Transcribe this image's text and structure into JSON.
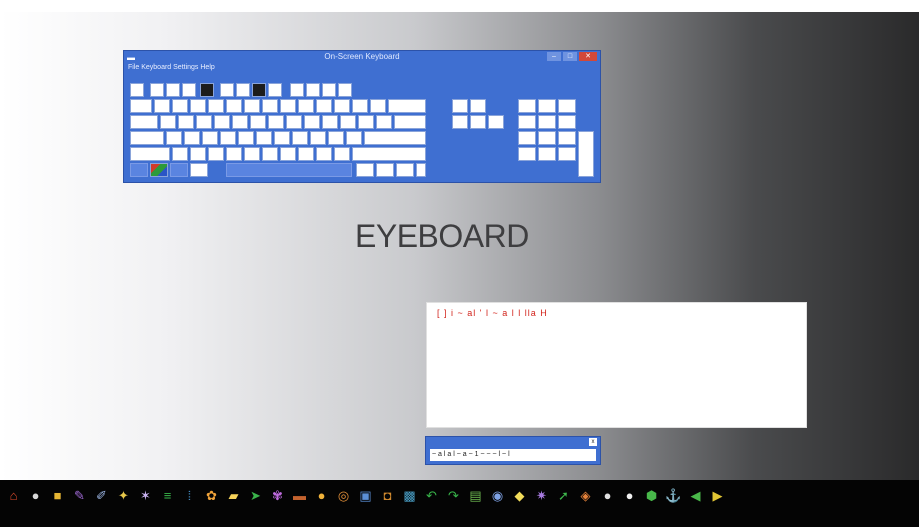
{
  "keyboard_window": {
    "title": "On-Screen Keyboard",
    "menu": "File Keyboard Settings Help",
    "controls": {
      "minimize": "–",
      "maximize": "□",
      "close": "✕"
    }
  },
  "app_title": "EYEBOARD",
  "output": {
    "typed_text": "[ ] i ~ al ' l ~ a l l lla H"
  },
  "mini_window": {
    "row_text": "~ a l a l ~ a ~ 1 ~ ~ ~ l ~ l",
    "close": "x"
  },
  "taskbar": {
    "icons": [
      {
        "name": "home-icon",
        "glyph": "⌂",
        "color": "#e04b2d"
      },
      {
        "name": "disc-icon",
        "glyph": "●",
        "color": "#d8d8d8"
      },
      {
        "name": "folder-icon",
        "glyph": "■",
        "color": "#e6b533"
      },
      {
        "name": "pencil-icon",
        "glyph": "✎",
        "color": "#a06ad6"
      },
      {
        "name": "brush-icon",
        "glyph": "✐",
        "color": "#9ab3e0"
      },
      {
        "name": "wand-icon",
        "glyph": "✦",
        "color": "#e7c74a"
      },
      {
        "name": "star-tools-icon",
        "glyph": "✶",
        "color": "#c9b2f0"
      },
      {
        "name": "list-icon",
        "glyph": "≡",
        "color": "#39b84a"
      },
      {
        "name": "grid-icon",
        "glyph": "⦙",
        "color": "#4a9ad6"
      },
      {
        "name": "paint-icon",
        "glyph": "✿",
        "color": "#f0a33a"
      },
      {
        "name": "eraser-icon",
        "glyph": "▰",
        "color": "#f6d35a"
      },
      {
        "name": "arrow-icon",
        "glyph": "➤",
        "color": "#3ab34a"
      },
      {
        "name": "spray-icon",
        "glyph": "✾",
        "color": "#c06be0"
      },
      {
        "name": "book-icon",
        "glyph": "▬",
        "color": "#c3622e"
      },
      {
        "name": "pin-icon",
        "glyph": "●",
        "color": "#f0b23a"
      },
      {
        "name": "film-icon",
        "glyph": "◎",
        "color": "#e6923a"
      },
      {
        "name": "picture-icon",
        "glyph": "▣",
        "color": "#5b8fd6"
      },
      {
        "name": "camera-icon",
        "glyph": "◘",
        "color": "#d0892e"
      },
      {
        "name": "image-icon",
        "glyph": "▩",
        "color": "#4aa0c8"
      },
      {
        "name": "undo-icon",
        "glyph": "↶",
        "color": "#38b54a"
      },
      {
        "name": "redo-icon",
        "glyph": "↷",
        "color": "#38b54a"
      },
      {
        "name": "gallery-icon",
        "glyph": "▤",
        "color": "#6db851"
      },
      {
        "name": "palette-icon",
        "glyph": "◉",
        "color": "#7fa3e6"
      },
      {
        "name": "rubber-icon",
        "glyph": "◆",
        "color": "#f2dc5a"
      },
      {
        "name": "sparkle-icon",
        "glyph": "✷",
        "color": "#a87be0"
      },
      {
        "name": "cursor-icon",
        "glyph": "➚",
        "color": "#3fb84d"
      },
      {
        "name": "fill-icon",
        "glyph": "◈",
        "color": "#e6823a"
      },
      {
        "name": "bulb-icon",
        "glyph": "●",
        "color": "#e0e0e0"
      },
      {
        "name": "balloon-icon",
        "glyph": "●",
        "color": "#f0f0f0"
      },
      {
        "name": "shield-icon",
        "glyph": "⬢",
        "color": "#48b84a"
      },
      {
        "name": "anchor-icon",
        "glyph": "⚓",
        "color": "#3aa646"
      },
      {
        "name": "back-icon",
        "glyph": "◀",
        "color": "#49b849"
      },
      {
        "name": "forward-icon",
        "glyph": "▶",
        "color": "#e2c634"
      }
    ]
  }
}
